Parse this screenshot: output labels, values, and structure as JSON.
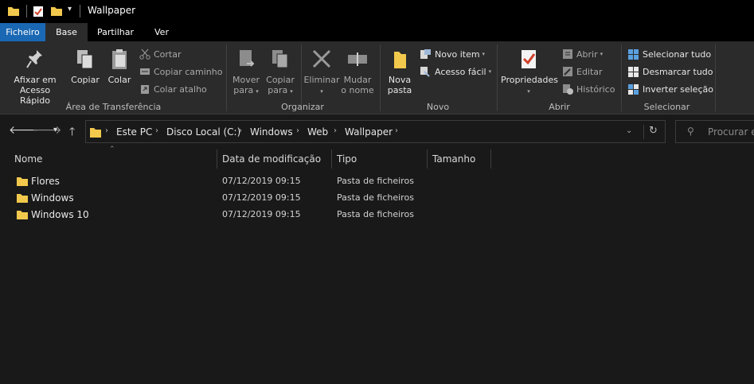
{
  "window": {
    "title": "Wallpaper"
  },
  "tabs": [
    {
      "label": "Ficheiro"
    },
    {
      "label": "Base"
    },
    {
      "label": "Partilhar"
    },
    {
      "label": "Ver"
    }
  ],
  "ribbon": {
    "clipboard": {
      "group_label": "Área de Transferência",
      "pin_line1": "Afixar em",
      "pin_line2": "Acesso Rápido",
      "copy": "Copiar",
      "paste": "Colar",
      "cut": "Cortar",
      "copy_path": "Copiar caminho",
      "paste_shortcut": "Colar atalho"
    },
    "organize": {
      "group_label": "Organizar",
      "move_line1": "Mover",
      "move_line2": "para",
      "copyto_line1": "Copiar",
      "copyto_line2": "para",
      "delete": "Eliminar",
      "rename_line1": "Mudar",
      "rename_line2": "o nome"
    },
    "new": {
      "group_label": "Novo",
      "folder_line1": "Nova",
      "folder_line2": "pasta",
      "new_item": "Novo item",
      "easy_access": "Acesso fácil"
    },
    "open": {
      "group_label": "Abrir",
      "properties": "Propriedades",
      "open": "Abrir",
      "edit": "Editar",
      "history": "Histórico"
    },
    "select": {
      "group_label": "Selecionar",
      "select_all": "Selecionar tudo",
      "select_none": "Desmarcar tudo",
      "invert": "Inverter seleção"
    }
  },
  "address": {
    "crumbs": [
      "Este PC",
      "Disco Local (C:)",
      "Windows",
      "Web",
      "Wallpaper"
    ],
    "search_placeholder": "Procurar em"
  },
  "columns": {
    "name": "Nome",
    "modified": "Data de modificação",
    "type": "Tipo",
    "size": "Tamanho"
  },
  "files": [
    {
      "name": "Flores",
      "modified": "07/12/2019 09:15",
      "type": "Pasta de ficheiros",
      "size": ""
    },
    {
      "name": "Windows",
      "modified": "07/12/2019 09:15",
      "type": "Pasta de ficheiros",
      "size": ""
    },
    {
      "name": "Windows 10",
      "modified": "07/12/2019 09:15",
      "type": "Pasta de ficheiros",
      "size": ""
    }
  ],
  "colors": {
    "accent": "#1a68b4",
    "folder": "#f2c94c",
    "background": "#191919",
    "ribbon": "#2b2b2b"
  }
}
